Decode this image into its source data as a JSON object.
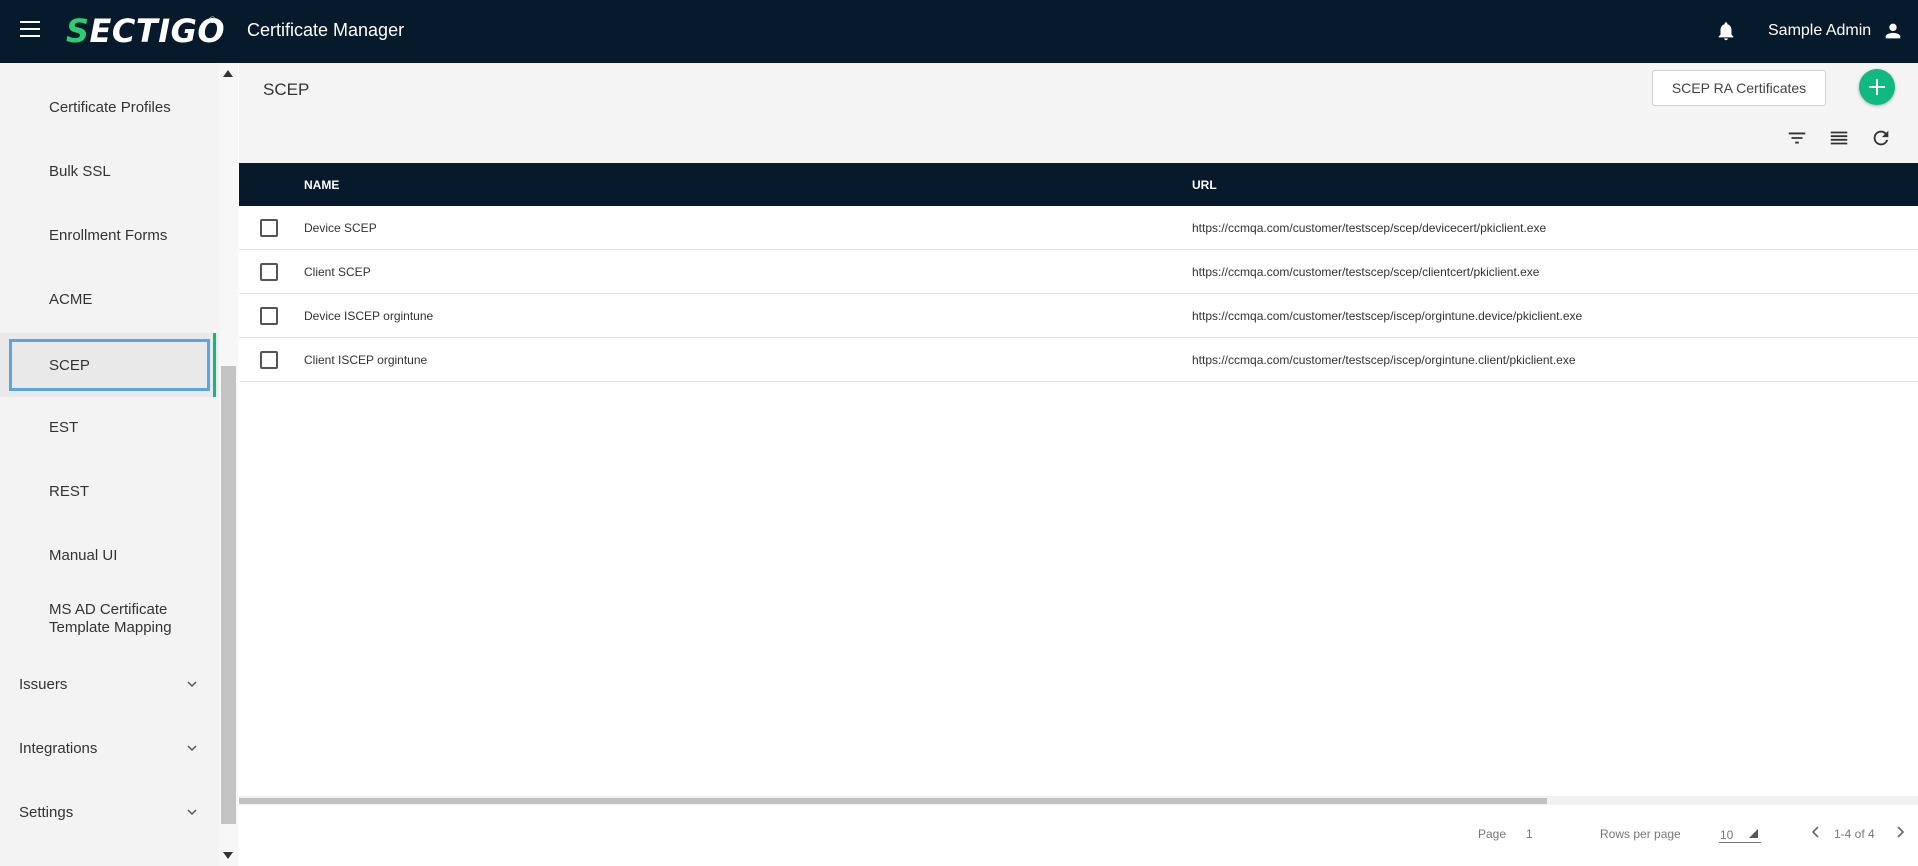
{
  "header": {
    "logo_text": "SECTIGO",
    "logo_s": "S",
    "logo_rest": "ECTIGO",
    "logo_reg": "®",
    "app_title": "Certificate Manager",
    "user_name": "Sample Admin",
    "colors": {
      "bar": "#061a2b",
      "brand_green": "#10b981"
    }
  },
  "sidebar": {
    "items": [
      {
        "label": "Certificate Profiles"
      },
      {
        "label": "Bulk SSL"
      },
      {
        "label": "Enrollment Forms"
      },
      {
        "label": "ACME"
      },
      {
        "label": "SCEP",
        "active": true
      },
      {
        "label": "EST"
      },
      {
        "label": "REST"
      },
      {
        "label": "Manual UI"
      },
      {
        "label_line1": "MS AD Certificate",
        "label_line2": "Template Mapping"
      }
    ],
    "groups": [
      {
        "label": "Issuers"
      },
      {
        "label": "Integrations"
      },
      {
        "label": "Settings"
      }
    ]
  },
  "main": {
    "title": "SCEP",
    "ra_button": "SCEP RA Certificates",
    "icons": [
      "add-icon",
      "filter-icon",
      "columns-icon",
      "refresh-icon"
    ]
  },
  "table": {
    "columns": [
      "NAME",
      "URL"
    ],
    "rows": [
      {
        "name": "Device SCEP",
        "url": "https://ccmqa.com/customer/testscep/scep/devicecert/pkiclient.exe"
      },
      {
        "name": "Client SCEP",
        "url": "https://ccmqa.com/customer/testscep/scep/clientcert/pkiclient.exe"
      },
      {
        "name": "Device ISCEP orgintune",
        "url": "https://ccmqa.com/customer/testscep/iscep/orgintune.device/pkiclient.exe"
      },
      {
        "name": "Client ISCEP orgintune",
        "url": "https://ccmqa.com/customer/testscep/iscep/orgintune.client/pkiclient.exe"
      }
    ]
  },
  "footer": {
    "page_label": "Page",
    "page_value": "1",
    "rows_label": "Rows per page",
    "rows_value": "10",
    "range": "1-4 of 4"
  }
}
